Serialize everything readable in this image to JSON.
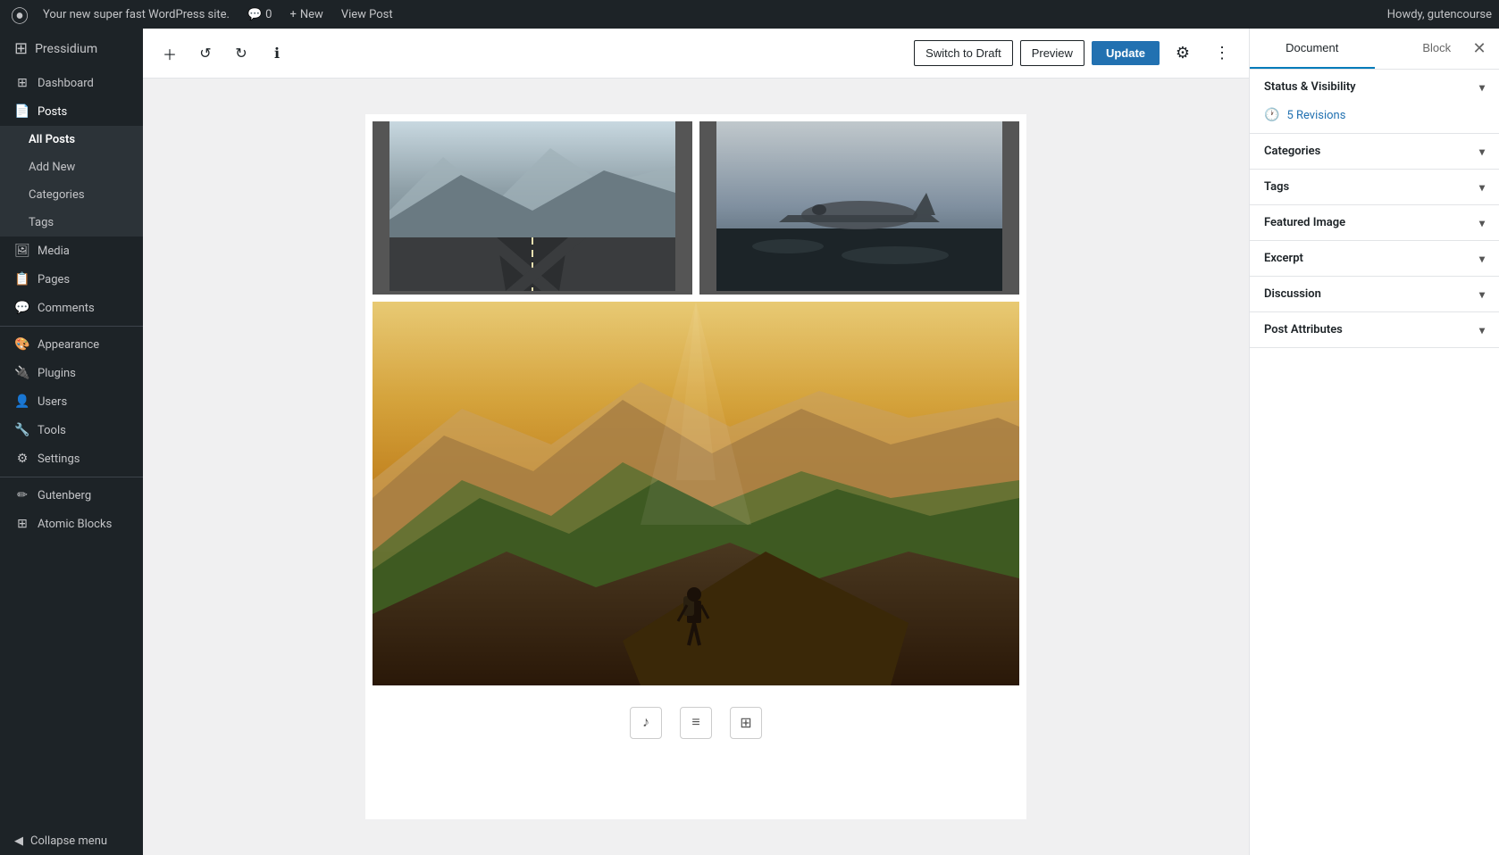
{
  "adminBar": {
    "wpLogoAlt": "WordPress",
    "siteName": "Your new super fast WordPress site.",
    "commentsCount": "0",
    "newLabel": "New",
    "viewPostLabel": "View Post",
    "howdy": "Howdy, gutencourse"
  },
  "sidebar": {
    "brand": "Pressidium",
    "items": [
      {
        "id": "dashboard",
        "label": "Dashboard",
        "icon": "⊞"
      },
      {
        "id": "posts",
        "label": "Posts",
        "icon": "📄",
        "active": true
      },
      {
        "id": "all-posts",
        "label": "All Posts",
        "sub": true,
        "active": true
      },
      {
        "id": "add-new",
        "label": "Add New",
        "sub": true
      },
      {
        "id": "categories",
        "label": "Categories",
        "sub": true
      },
      {
        "id": "tags",
        "label": "Tags",
        "sub": true
      },
      {
        "id": "media",
        "label": "Media",
        "icon": "🖼"
      },
      {
        "id": "pages",
        "label": "Pages",
        "icon": "📋"
      },
      {
        "id": "comments",
        "label": "Comments",
        "icon": "💬"
      },
      {
        "id": "appearance",
        "label": "Appearance",
        "icon": "🎨"
      },
      {
        "id": "plugins",
        "label": "Plugins",
        "icon": "🔌"
      },
      {
        "id": "users",
        "label": "Users",
        "icon": "👤"
      },
      {
        "id": "tools",
        "label": "Tools",
        "icon": "🔧"
      },
      {
        "id": "settings",
        "label": "Settings",
        "icon": "⚙"
      },
      {
        "id": "gutenberg",
        "label": "Gutenberg",
        "icon": "✏"
      },
      {
        "id": "atomic-blocks",
        "label": "Atomic Blocks",
        "icon": "⊞"
      }
    ],
    "collapseLabel": "Collapse menu"
  },
  "toolbar": {
    "addBlockTooltip": "Add block",
    "undoTooltip": "Undo",
    "redoTooltip": "Redo",
    "infoTooltip": "Information",
    "switchToDraftLabel": "Switch to Draft",
    "previewLabel": "Preview",
    "updateLabel": "Update",
    "settingsTooltip": "Settings",
    "moreTooltip": "More tools & options"
  },
  "rightPanel": {
    "documentTab": "Document",
    "blockTab": "Block",
    "sections": [
      {
        "id": "status-visibility",
        "label": "Status & Visibility"
      },
      {
        "id": "revisions",
        "label": "5 Revisions",
        "isRevisions": true
      },
      {
        "id": "categories",
        "label": "Categories"
      },
      {
        "id": "tags",
        "label": "Tags"
      },
      {
        "id": "featured-image",
        "label": "Featured Image"
      },
      {
        "id": "excerpt",
        "label": "Excerpt"
      },
      {
        "id": "discussion",
        "label": "Discussion"
      },
      {
        "id": "post-attributes",
        "label": "Post Attributes"
      }
    ]
  },
  "bottomControls": [
    {
      "id": "audio-icon",
      "symbol": "♪",
      "label": "Audio"
    },
    {
      "id": "list-icon",
      "symbol": "≡",
      "label": "List"
    },
    {
      "id": "gallery-icon",
      "symbol": "⊞",
      "label": "Gallery"
    }
  ]
}
